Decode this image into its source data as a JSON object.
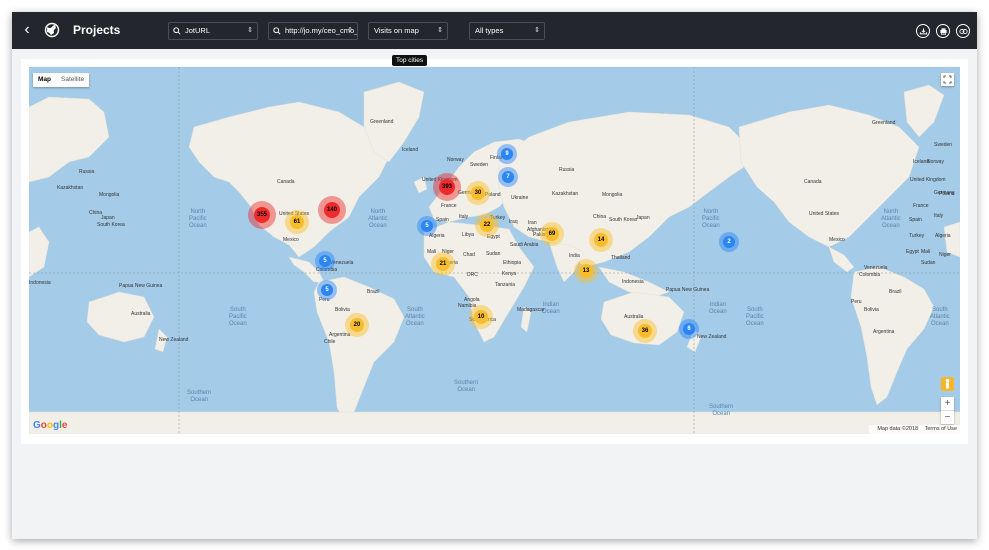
{
  "header": {
    "back_icon": "chevron-left-icon",
    "logo_icon": "globe-icon",
    "title": "Projects",
    "filters": [
      {
        "value": "JotURL",
        "icon": "search-icon"
      },
      {
        "value": "http://jo.my/ceo_cmo_",
        "icon": "search-icon"
      },
      {
        "value": "Visits on map"
      },
      {
        "value": "All types"
      }
    ],
    "tooltip": "Top cities",
    "actions": [
      {
        "icon": "download-icon"
      },
      {
        "icon": "print-icon"
      },
      {
        "icon": "compare-icon"
      }
    ]
  },
  "map": {
    "type_control": {
      "map": "Map",
      "satellite": "Satellite",
      "active": "Map"
    },
    "google_logo": "Google",
    "attribution": {
      "data": "Map data ©2018",
      "terms": "Terms of Use"
    },
    "zoom": {
      "in": "+",
      "out": "−"
    },
    "oceans": [
      "North\nPacific\nOcean",
      "North\nAtlantic\nOcean",
      "South\nPacific\nOcean",
      "South\nAtlantic\nOcean",
      "Indian\nOcean",
      "Southern\nOcean",
      "Southern\nOcean",
      "Indian\nOcean",
      "North\nPacific\nOcean",
      "North\nAtlantic\nOcean",
      "South\nPacific\nOcean",
      "South\nAtlantic\nOcean",
      "Southern\nOcean"
    ],
    "places": [
      "Greenland",
      "Iceland",
      "Canada",
      "United States",
      "Mexico",
      "Venezuela",
      "Colombia",
      "Peru",
      "Brazil",
      "Bolivia",
      "Chile",
      "Argentina",
      "Sweden",
      "Finland",
      "Norway",
      "United Kingdom",
      "Poland",
      "Ukraine",
      "Germany",
      "France",
      "Spain",
      "Italy",
      "Turkey",
      "Iraq",
      "Iran",
      "Algeria",
      "Libya",
      "Egypt",
      "Saudi Arabia",
      "Mali",
      "Niger",
      "Chad",
      "Sudan",
      "Nigeria",
      "Ethiopia",
      "DRC",
      "Kenya",
      "Tanzania",
      "Angola",
      "Namibia",
      "South Africa",
      "Madagascar",
      "Russia",
      "Kazakhstan",
      "Mongolia",
      "China",
      "Afghanistan",
      "Pakistan",
      "India",
      "Thailand",
      "Indonesia",
      "Papua New Guinea",
      "Australia",
      "New Zealand",
      "Japan",
      "South Korea",
      "Russia",
      "Kazakhstan",
      "Mongolia",
      "China",
      "Japan",
      "South Korea",
      "Indonesia",
      "Papua New Guinea",
      "Australia",
      "New Zealand",
      "Greenland",
      "Iceland",
      "Canada",
      "United States",
      "Mexico",
      "Venezuela",
      "Colombia",
      "Peru",
      "Brazil",
      "Bolivia",
      "Argentina",
      "Sweden",
      "Finland",
      "Norway",
      "United Kingdom",
      "Poland",
      "Ukraine",
      "Germany",
      "France",
      "Spain",
      "Italy",
      "Turkey",
      "Algeria",
      "Libya",
      "Egypt",
      "Mali",
      "Niger",
      "Chad",
      "Sudan",
      "Nigeria",
      "Ethiopia"
    ],
    "clusters": [
      {
        "count": "61",
        "color": "yellow"
      },
      {
        "count": "355",
        "color": "red"
      },
      {
        "count": "140",
        "color": "red"
      },
      {
        "count": "5",
        "color": "blue"
      },
      {
        "count": "5",
        "color": "blue"
      },
      {
        "count": "20",
        "color": "yellow"
      },
      {
        "count": "5",
        "color": "blue"
      },
      {
        "count": "393",
        "color": "red"
      },
      {
        "count": "30",
        "color": "yellow"
      },
      {
        "count": "7",
        "color": "blue"
      },
      {
        "count": "9",
        "color": "blue"
      },
      {
        "count": "22",
        "color": "yellow"
      },
      {
        "count": "21",
        "color": "yellow"
      },
      {
        "count": "69",
        "color": "yellow"
      },
      {
        "count": "14",
        "color": "yellow"
      },
      {
        "count": "13",
        "color": "yellow"
      },
      {
        "count": "10",
        "color": "yellow"
      },
      {
        "count": "36",
        "color": "yellow"
      },
      {
        "count": "6",
        "color": "blue"
      },
      {
        "count": "2",
        "color": "blue"
      }
    ]
  }
}
